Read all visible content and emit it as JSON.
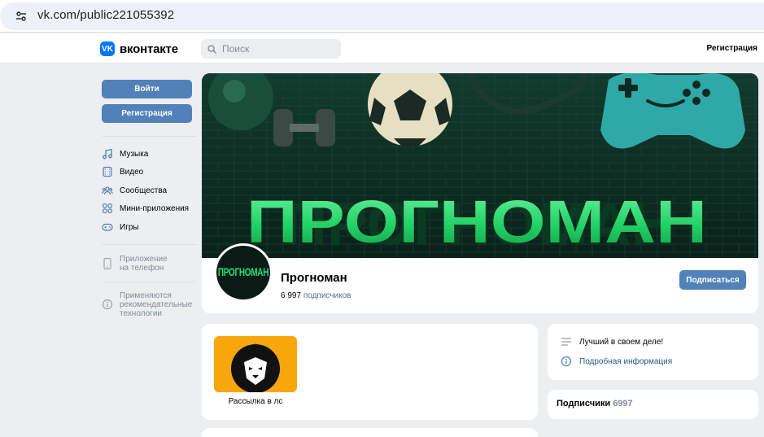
{
  "browser": {
    "url": "vk.com/public221055392",
    "site_info_icon": "tune-icon"
  },
  "header": {
    "logo_text": "вконтакте",
    "logo_mark": "VK",
    "search_placeholder": "Поиск",
    "register_label": "Регистрация"
  },
  "sidebar": {
    "login_label": "Войти",
    "register_label": "Регистрация",
    "items": [
      {
        "label": "Музыка",
        "icon": "music-icon"
      },
      {
        "label": "Видео",
        "icon": "video-icon"
      },
      {
        "label": "Сообщества",
        "icon": "communities-icon"
      },
      {
        "label": "Мини-приложения",
        "icon": "apps-icon"
      },
      {
        "label": "Игры",
        "icon": "gamepad-icon"
      }
    ],
    "app_promo": "Приложение на телефон",
    "app_promo_lines": [
      "Приложение",
      "на телефон"
    ],
    "tech_notice_lines": [
      "Применяются",
      "рекомендательные",
      "технологии"
    ]
  },
  "group": {
    "cover_title": "ПРОГНОМАН",
    "avatar_text": "ПРОГНОМАН",
    "name": "Прогноман",
    "subscribers_count": "6 997",
    "subscribers_label": "подписчиков",
    "subscribe_label": "Подписаться"
  },
  "album": {
    "caption": "Рассылка в лс"
  },
  "info": {
    "status": "Лучший в своем деле!",
    "details_link": "Подробная информация"
  },
  "followers": {
    "title": "Подписчики",
    "count": "6997"
  },
  "colors": {
    "vk_blue": "#0077ff",
    "button_blue": "#5181b8",
    "page_bg": "#edeef0",
    "cover_green": "#1fd968",
    "album_orange": "#f7a70c"
  }
}
